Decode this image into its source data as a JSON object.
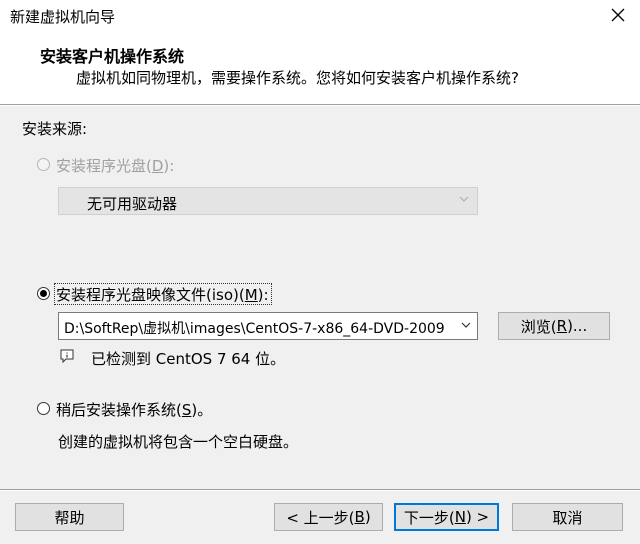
{
  "window": {
    "title": "新建虚拟机向导"
  },
  "header": {
    "title": "安装客户机操作系统",
    "subtitle": "虚拟机如同物理机，需要操作系统。您将如何安装客户机操作系统?"
  },
  "install_source_label": "安装来源:",
  "options": {
    "disc": {
      "label_pre": "安装程序光盘(",
      "label_key": "D",
      "label_post": "):",
      "selected": false,
      "enabled": false,
      "drive_value": "无可用驱动器"
    },
    "iso": {
      "label_pre": "安装程序光盘映像文件(iso)(",
      "label_key": "M",
      "label_post": "):",
      "selected": true,
      "enabled": true,
      "path_value": "D:\\SoftRep\\虚拟机\\images\\CentOS-7-x86_64-DVD-2009",
      "browse_pre": "浏览(",
      "browse_key": "R",
      "browse_post": ")...",
      "detected_text": "已检测到 CentOS 7 64 位。"
    },
    "later": {
      "label_pre": "稍后安装操作系统(",
      "label_key": "S",
      "label_post": ")。",
      "selected": false,
      "enabled": true,
      "description": "创建的虚拟机将包含一个空白硬盘。"
    }
  },
  "footer": {
    "help": "帮助",
    "back_pre": "< 上一步(",
    "back_key": "B",
    "back_post": ")",
    "next_pre": "下一步(",
    "next_key": "N",
    "next_post": ") >",
    "cancel": "取消"
  },
  "icons": {
    "close": "close-icon",
    "dropdown": "chevron-down-icon",
    "info": "info-icon"
  },
  "colors": {
    "default_button_border": "#0078d7",
    "disabled_text": "#a0a0a0"
  }
}
